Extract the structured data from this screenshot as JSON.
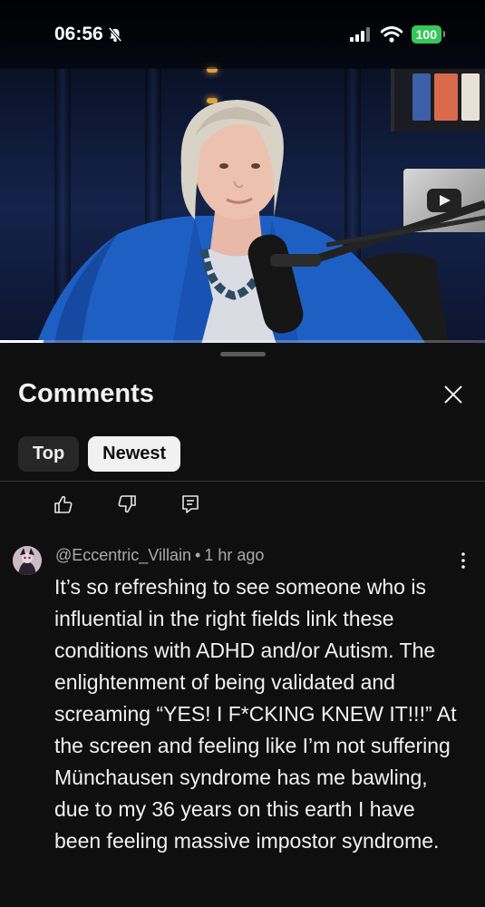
{
  "status_bar": {
    "time": "06:56",
    "battery": "100",
    "icons": [
      "bell-slash-icon",
      "cellular-signal-icon",
      "wifi-icon",
      "battery-icon"
    ]
  },
  "video": {
    "progress_fraction": 0.09
  },
  "comments_panel": {
    "title": "Comments",
    "close_icon": "close-icon",
    "chips": [
      {
        "label": "Top",
        "selected": false
      },
      {
        "label": "Newest",
        "selected": true
      }
    ],
    "previous_comment_actions": [
      "thumbs-up-icon",
      "thumbs-down-icon",
      "reply-icon"
    ]
  },
  "comment": {
    "author": "@Eccentric_Villain",
    "separator": "•",
    "time": "1 hr ago",
    "text": "It’s so refreshing to see someone who is influential in the right fields link these conditions with ADHD and/or Autism. The enlightenment of being validated and screaming “YES! I F*CKING KNEW IT!!!” At the screen and feeling like I’m not suffering Münchausen syndrome has me bawling, due to my 36 years on this earth I have been feeling massive impostor syndrome.",
    "menu_icon": "more-vertical-icon"
  },
  "colors": {
    "background": "#0f0f0f",
    "chip_active_bg": "#f1f1f1",
    "chip_inactive_bg": "#272727",
    "meta_text": "#aaaaaa",
    "battery_green": "#34c759"
  }
}
